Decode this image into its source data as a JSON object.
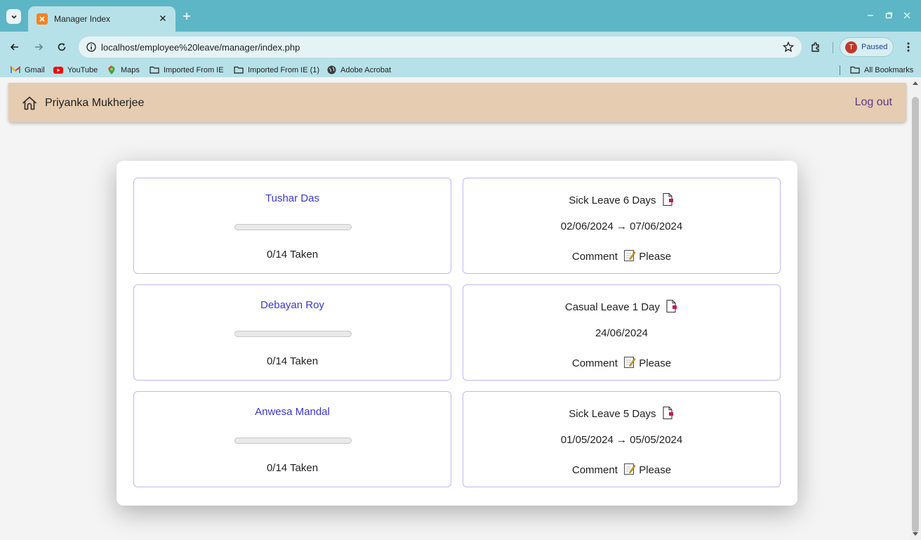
{
  "browser": {
    "tab_title": "Manager Index",
    "url": "localhost/employee%20leave/manager/index.php",
    "profile_initial": "T",
    "profile_status": "Paused",
    "bookmarks": [
      "Gmail",
      "YouTube",
      "Maps",
      "Imported From IE",
      "Imported From IE (1)",
      "Adobe Acrobat"
    ],
    "all_bookmarks": "All Bookmarks"
  },
  "header": {
    "user_name": "Priyanka Mukherjee",
    "logout_label": "Log out"
  },
  "employees": [
    {
      "name": "Tushar Das",
      "progress": 0,
      "taken": "0/14 Taken",
      "leave_label": "Sick Leave 6 Days",
      "dates": "02/06/2024 → 07/06/2024",
      "comment_label": "Comment",
      "comment_text": "Please"
    },
    {
      "name": "Debayan Roy",
      "progress": 0,
      "taken": "0/14 Taken",
      "leave_label": "Casual Leave 1 Day",
      "dates": "24/06/2024",
      "comment_label": "Comment",
      "comment_text": "Please"
    },
    {
      "name": "Anwesa Mandal",
      "progress": 0,
      "taken": "0/14 Taken",
      "leave_label": "Sick Leave 5 Days",
      "dates": "01/05/2024 → 05/05/2024",
      "comment_label": "Comment",
      "comment_text": "Please"
    }
  ],
  "colors": {
    "header_bg": "#e6ccb0",
    "card_border": "#bfb8f2",
    "employee_name": "#3a36d6",
    "browser_chrome": "#5db6c5"
  }
}
